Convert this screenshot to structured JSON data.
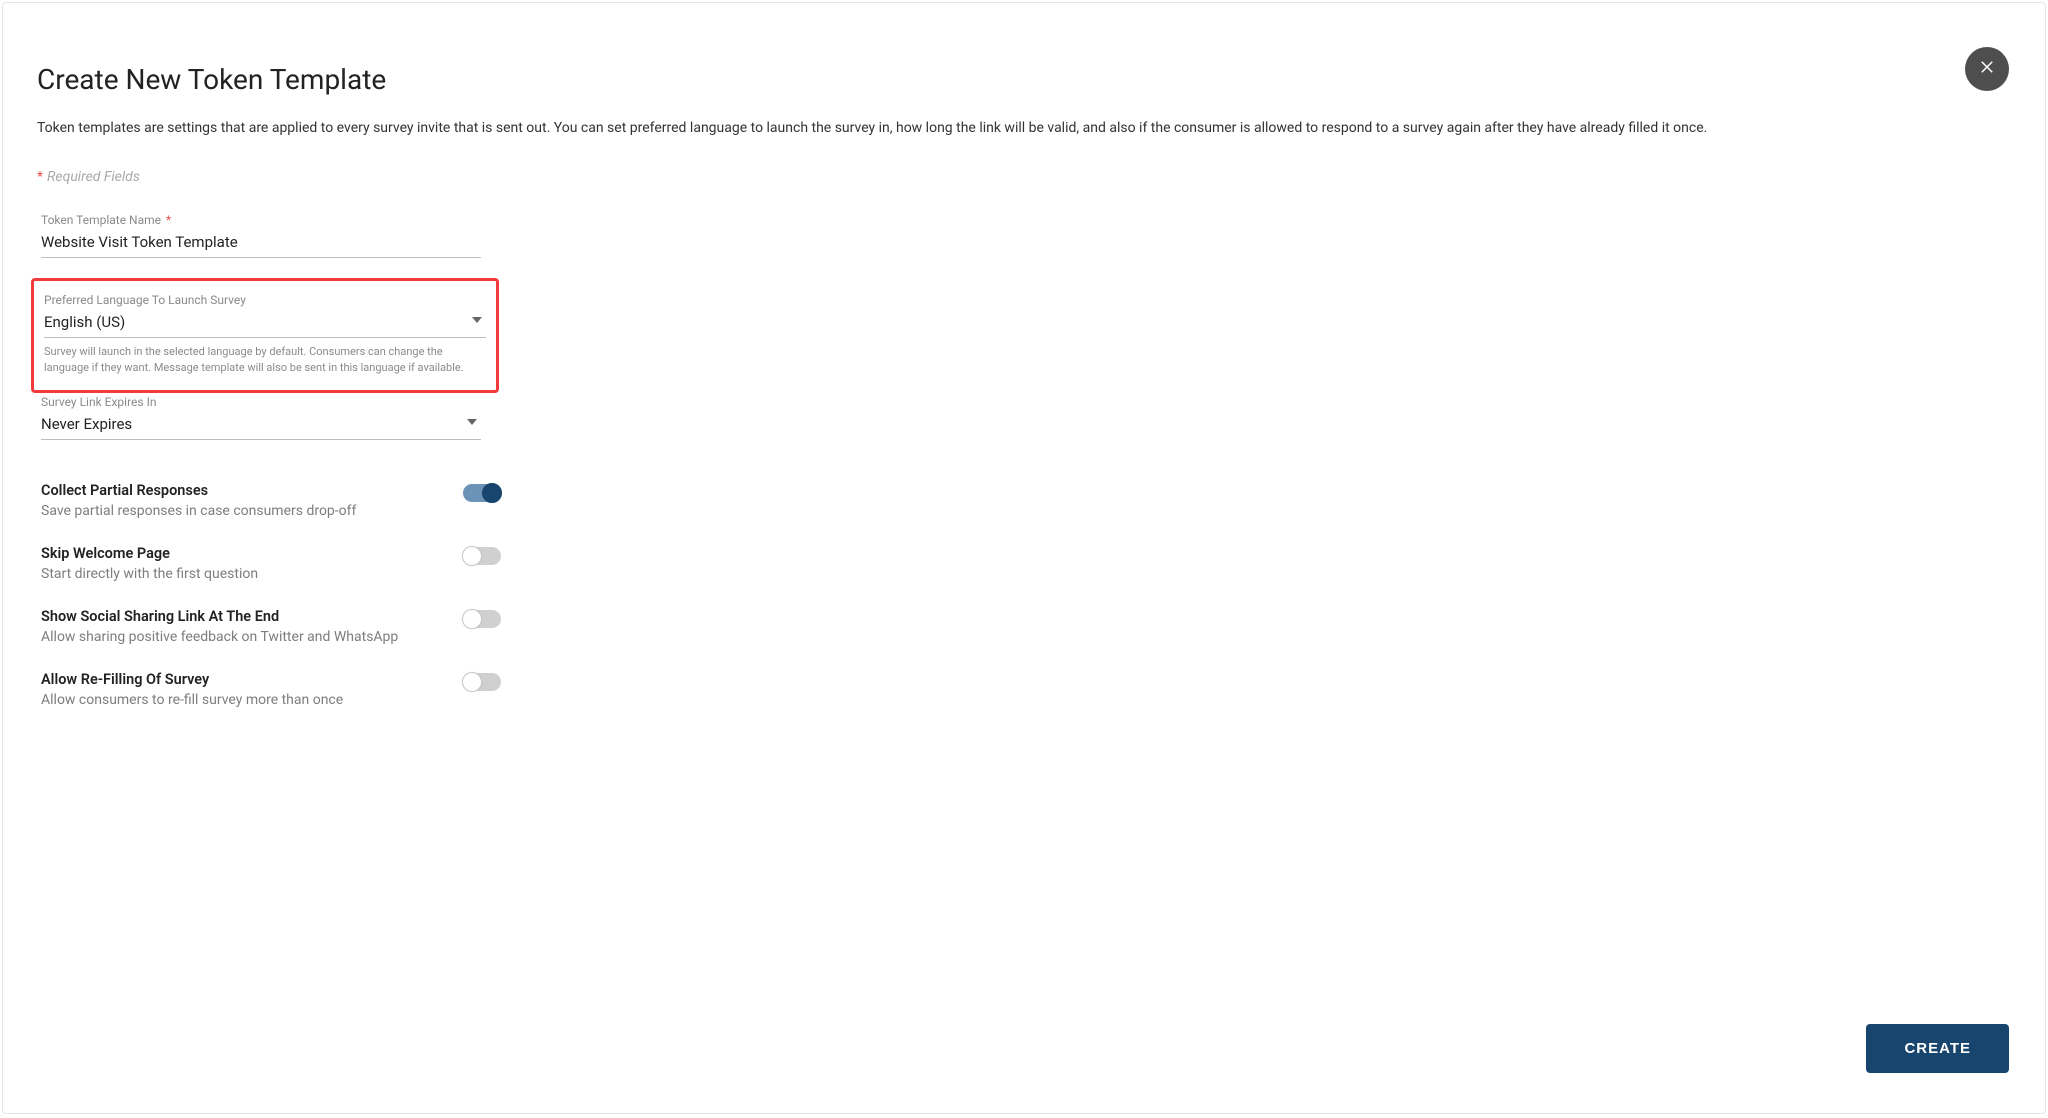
{
  "title": "Create New Token Template",
  "description": "Token templates are settings that are applied to every survey invite that is sent out. You can set preferred language to launch the survey in, how long the link will be valid, and also if the consumer is allowed to respond to a survey again after they have already filled it once.",
  "required_note": "Required Fields",
  "fields": {
    "name": {
      "label": "Token Template Name",
      "required_mark": "*",
      "value": "Website Visit Token Template"
    },
    "language": {
      "label": "Preferred Language To Launch Survey",
      "value": "English (US)",
      "help": "Survey will launch in the selected language by default. Consumers can change the language if they want. Message template will also be sent in this language if available."
    },
    "expiry": {
      "label": "Survey Link Expires In",
      "value": "Never Expires"
    }
  },
  "toggles": {
    "partial": {
      "title": "Collect Partial Responses",
      "sub": "Save partial responses in case consumers drop-off",
      "on": true
    },
    "welcome": {
      "title": "Skip Welcome Page",
      "sub": "Start directly with the first question",
      "on": false
    },
    "social": {
      "title": "Show Social Sharing Link At The End",
      "sub": "Allow sharing positive feedback on Twitter and WhatsApp",
      "on": false
    },
    "refill": {
      "title": "Allow Re-Filling Of Survey",
      "sub": "Allow consumers to re-fill survey more than once",
      "on": false
    }
  },
  "buttons": {
    "create": "CREATE"
  },
  "required_star": "*"
}
